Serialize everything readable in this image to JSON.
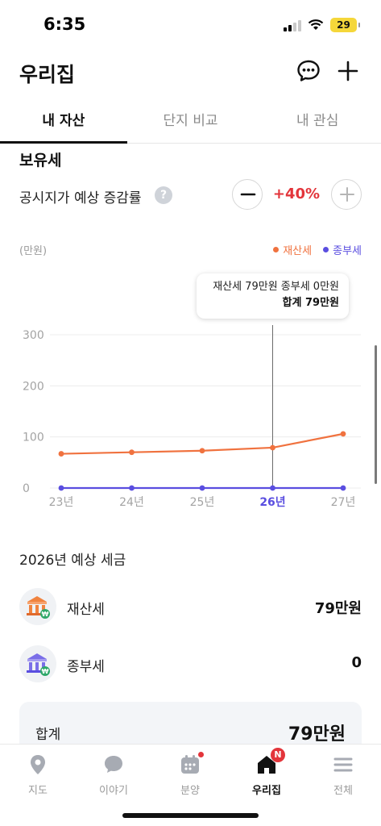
{
  "status_bar": {
    "time": "6:35",
    "battery": "29"
  },
  "header": {
    "title": "우리집"
  },
  "tabs": [
    {
      "label": "내 자산",
      "active": true
    },
    {
      "label": "단지 비교",
      "active": false
    },
    {
      "label": "내 관심",
      "active": false
    }
  ],
  "section": {
    "title": "보유세",
    "rate_label": "공시지가 예상 증감률",
    "rate_value": "+40%"
  },
  "chart_data": {
    "type": "line",
    "unit_label": "(만원)",
    "categories": [
      "23년",
      "24년",
      "25년",
      "26년",
      "27년"
    ],
    "y_ticks": [
      "300",
      "200",
      "100",
      "0"
    ],
    "ylim": [
      0,
      300
    ],
    "selected_category": "26년",
    "series": [
      {
        "name": "재산세",
        "color": "#f0723f",
        "values": [
          67,
          70,
          73,
          79,
          106
        ]
      },
      {
        "name": "종부세",
        "color": "#5a4ee0",
        "values": [
          0,
          0,
          0,
          0,
          0
        ]
      }
    ],
    "tooltip": {
      "line1": "재산세 79만원 종부세 0만원",
      "line2": "합계 79만원"
    },
    "grid": true,
    "legend_position": "top-right"
  },
  "tax_summary": {
    "title": "2026년 예상 세금",
    "items": [
      {
        "name": "재산세",
        "amount": "79만원"
      },
      {
        "name": "종부세",
        "amount": "0"
      }
    ],
    "total_label": "합계",
    "total_amount": "79만원"
  },
  "bottom_nav": [
    {
      "label": "지도",
      "icon": "map-pin-icon",
      "active": false
    },
    {
      "label": "이야기",
      "icon": "chat-bubble-icon",
      "active": false
    },
    {
      "label": "분양",
      "icon": "calendar-icon",
      "active": false
    },
    {
      "label": "우리집",
      "icon": "home-icon",
      "active": true,
      "badge": "N"
    },
    {
      "label": "전체",
      "icon": "menu-icon",
      "active": false
    }
  ],
  "colors": {
    "accent_red": "#e3353b",
    "property_tax": "#f0723f",
    "comprehensive_tax": "#5a4ee0"
  }
}
